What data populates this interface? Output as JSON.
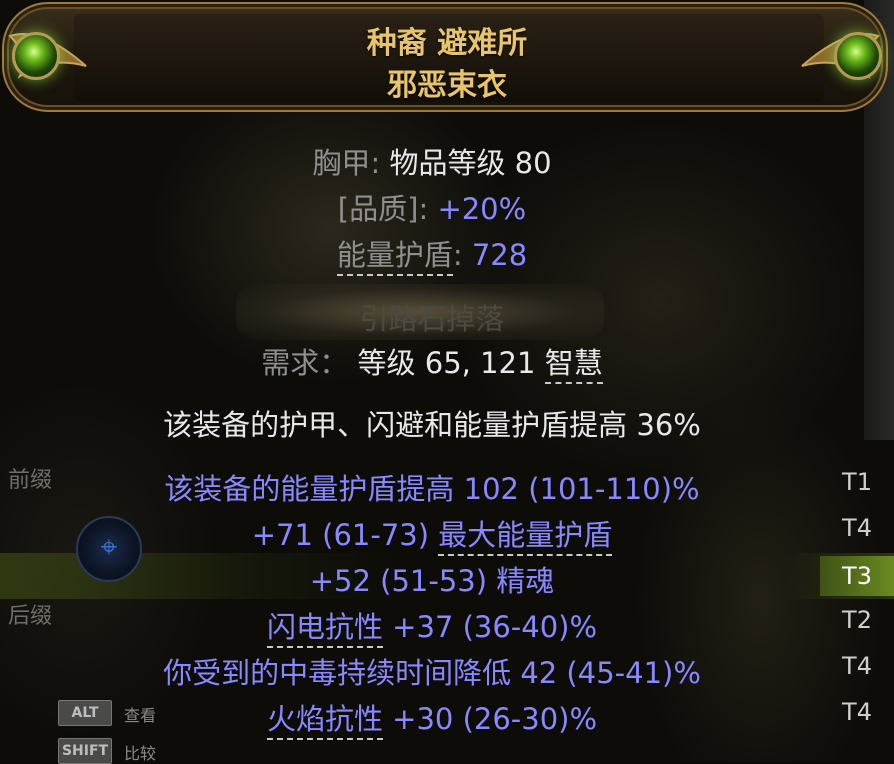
{
  "header": {
    "name": "种裔 避难所",
    "base_type": "邪恶束衣"
  },
  "properties": {
    "item_class": "胸甲",
    "item_level_label": "物品等级",
    "item_level": "80",
    "quality_label": "[品质]",
    "quality_value": "+20%",
    "es_label": "能量护盾",
    "es_value": "728"
  },
  "separator_text": "引路石掉落",
  "requirements": {
    "label": "需求：",
    "level_label": "等级",
    "level_value": "65",
    "int_value": "121",
    "int_label": "智慧"
  },
  "implicit": "该装备的护甲、闪避和能量护盾提高 36%",
  "mods": [
    {
      "text": "该装备的能量护盾提高 102 (101-110)%",
      "tier": "T1"
    },
    {
      "text_pre": "+71 (61-73) ",
      "text_keyword": "最大能量护盾",
      "tier": "T4"
    },
    {
      "text": "+52 (51-53) 精魂",
      "tier": "T3"
    },
    {
      "text_keyword": "闪电抗性",
      "text_post": " +37 (36-40)%",
      "tier": "T2"
    },
    {
      "text": "你受到的中毒持续时间降低 42 (45-41)%",
      "tier": "T4"
    },
    {
      "text_keyword": "火焰抗性",
      "text_post": " +30 (26-30)%",
      "tier": "T4"
    }
  ],
  "side_panel": {
    "prefix_label": "前缀",
    "suffix_label": "后缀",
    "alt_key": "ALT",
    "alt_label": "查看",
    "shift_key": "SHIFT",
    "shift_label": "比较"
  },
  "colors": {
    "title": "#e8c46a",
    "magic_value": "#8888ff",
    "label": "#8f8f8f",
    "tier_active_bg": "#6b8a22"
  }
}
